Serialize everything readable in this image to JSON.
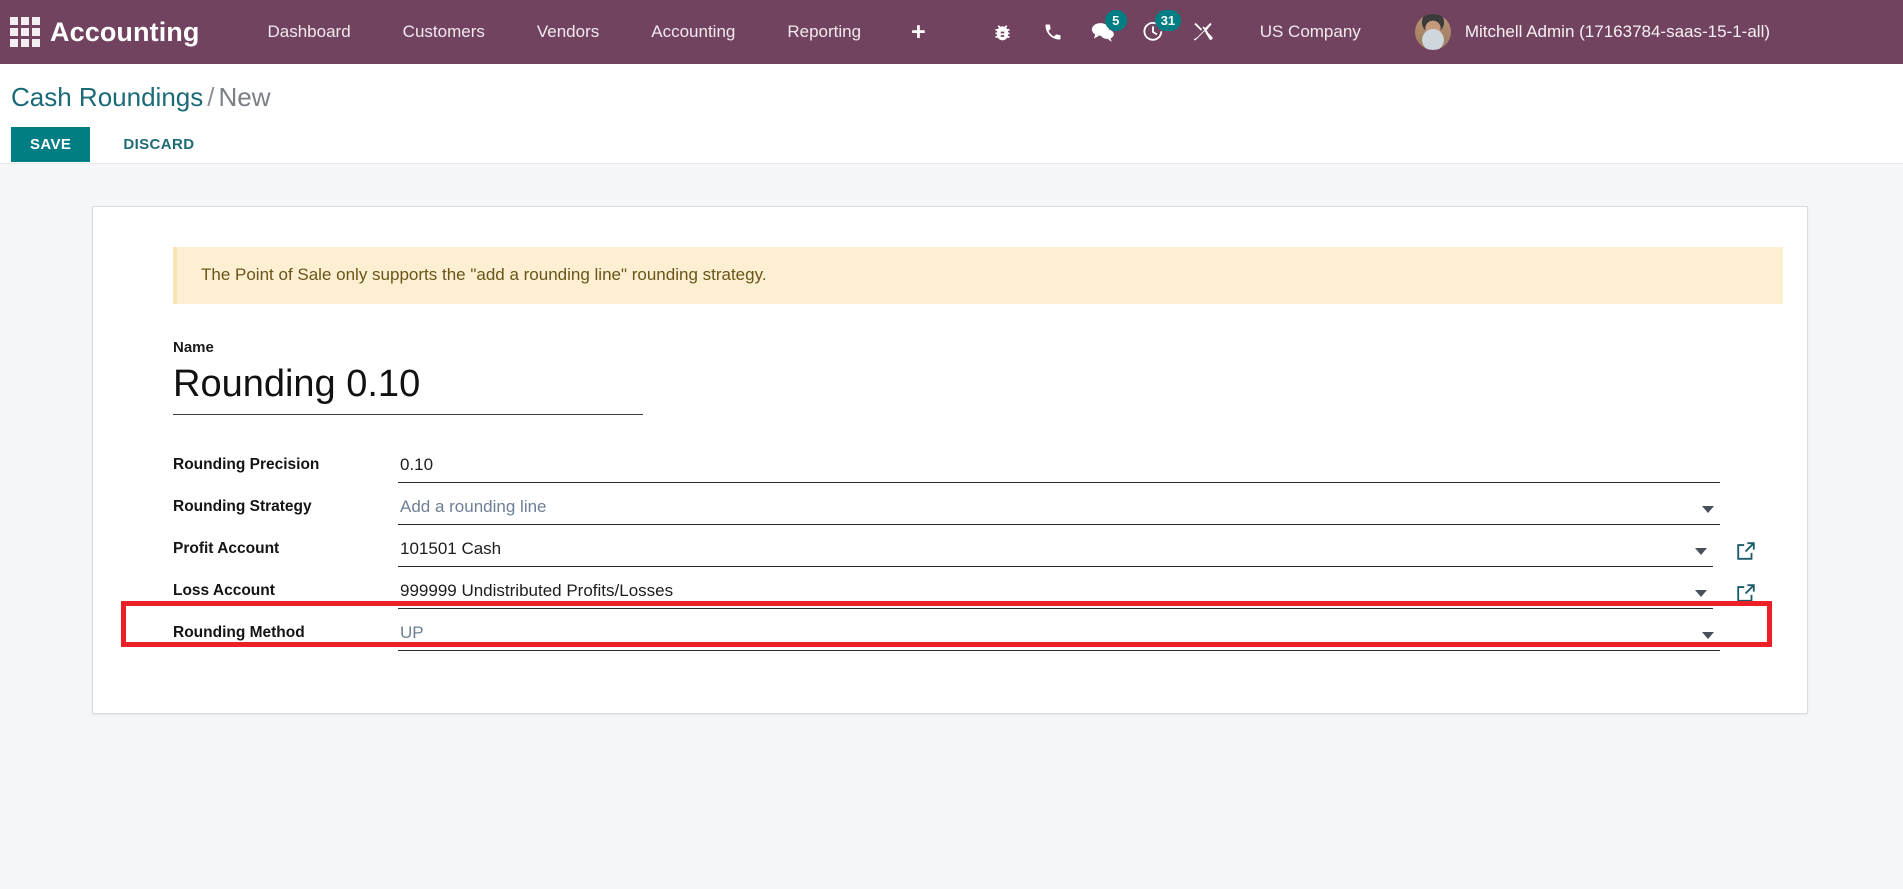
{
  "navbar": {
    "apps_icon": "apps-grid-icon",
    "brand": "Accounting",
    "menu_items": [
      {
        "label": "Dashboard",
        "name": "menu-dashboard"
      },
      {
        "label": "Customers",
        "name": "menu-customers"
      },
      {
        "label": "Vendors",
        "name": "menu-vendors"
      },
      {
        "label": "Accounting",
        "name": "menu-accounting"
      },
      {
        "label": "Reporting",
        "name": "menu-reporting"
      }
    ],
    "plus_label": "+",
    "sys_icons": [
      {
        "name": "bug-icon",
        "badge": null
      },
      {
        "name": "phone-icon",
        "badge": null
      },
      {
        "name": "messages-icon",
        "badge": "5"
      },
      {
        "name": "activities-clock-icon",
        "badge": "31"
      },
      {
        "name": "tools-wrench-icon",
        "badge": null
      }
    ],
    "messages_count": "5",
    "activities_count": "31",
    "company": "US Company",
    "user": "Mitchell Admin (17163784-saas-15-1-all)",
    "bg_color": "#71435f",
    "badge_color": "#017e84"
  },
  "control_panel": {
    "breadcrumb_root": "Cash Roundings",
    "breadcrumb_sep": "/",
    "breadcrumb_current": "New",
    "save_label": "SAVE",
    "discard_label": "DISCARD",
    "save_color": "#017e84",
    "discard_color": "#1e6b76"
  },
  "form": {
    "alert_text": "The Point of Sale only supports the \"add a rounding line\" rounding strategy.",
    "alert_bg": "#fcefd2",
    "name_label": "Name",
    "name_value": "Rounding 0.10",
    "fields": [
      {
        "label": "Rounding Precision",
        "value": "0.10",
        "muted": false,
        "has_caret": false,
        "has_extlink": false,
        "name": "rounding-precision"
      },
      {
        "label": "Rounding Strategy",
        "value": "Add a rounding line",
        "muted": true,
        "has_caret": true,
        "has_extlink": false,
        "name": "rounding-strategy"
      },
      {
        "label": "Profit Account",
        "value": "101501 Cash",
        "muted": false,
        "has_caret": true,
        "has_extlink": true,
        "name": "profit-account"
      },
      {
        "label": "Loss Account",
        "value": "999999 Undistributed Profits/Losses",
        "muted": false,
        "has_caret": true,
        "has_extlink": true,
        "name": "loss-account"
      },
      {
        "label": "Rounding Method",
        "value": "UP",
        "muted": true,
        "has_caret": true,
        "has_extlink": false,
        "name": "rounding-method"
      }
    ]
  },
  "annotation": {
    "target": "rounding-method-row",
    "color": "#ee2027"
  }
}
